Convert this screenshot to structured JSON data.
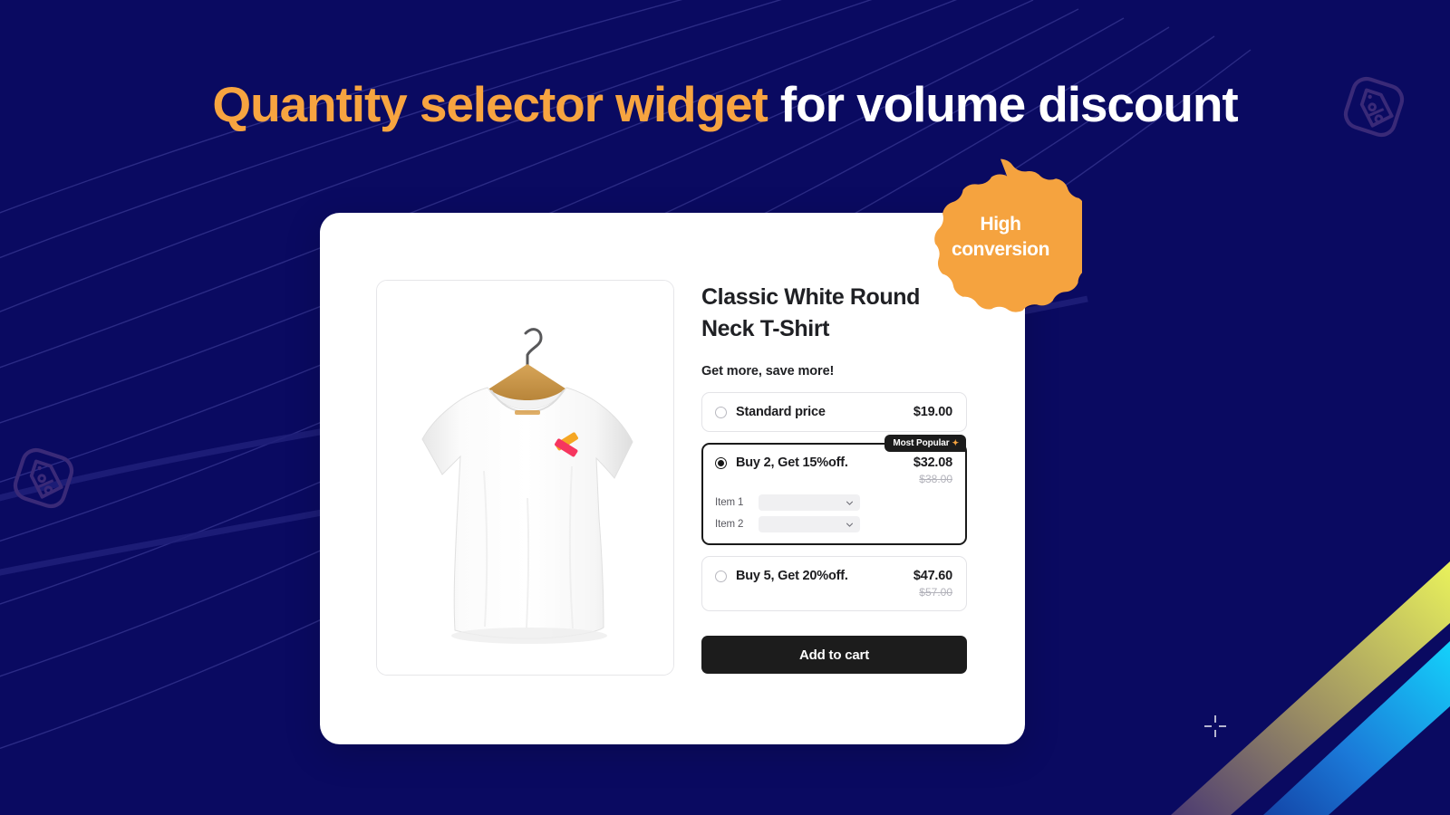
{
  "headline": {
    "accent_text": "Quantity selector widget",
    "rest_text": " for volume discount"
  },
  "badge": {
    "line1": "High",
    "line2": "conversion"
  },
  "product": {
    "title": "Classic White Round Neck T-Shirt",
    "subhead": "Get more, save more!",
    "image_alt": "white-tshirt-on-hanger"
  },
  "offers": [
    {
      "id": "standard",
      "label": "Standard price",
      "price": "$19.00",
      "compare_at": "",
      "selected": false,
      "badge": "",
      "items": []
    },
    {
      "id": "buy2",
      "label": "Buy 2, Get 15%off.",
      "price": "$32.08",
      "compare_at": "$38.00",
      "selected": true,
      "badge": "Most Popular",
      "badge_icon": "sparkle-icon",
      "items": [
        {
          "label": "Item 1",
          "value": ""
        },
        {
          "label": "Item 2",
          "value": ""
        }
      ]
    },
    {
      "id": "buy5",
      "label": "Buy 5, Get 20%off.",
      "price": "$47.60",
      "compare_at": "$57.00",
      "selected": false,
      "badge": "",
      "items": []
    }
  ],
  "cta": {
    "add_to_cart_label": "Add to cart"
  },
  "decorations": {
    "top_right_icon": "discount-tag-icon",
    "bottom_left_icon": "discount-tag-icon",
    "corner_marker": "crosshair-marker"
  },
  "colors": {
    "background": "#0a0a61",
    "accent_orange": "#f7a440",
    "text_dark": "#1c1c1f",
    "card_white": "#ffffff",
    "stripe_yellow": "#e6ee5a",
    "stripe_cyan": "#13c2f5"
  }
}
